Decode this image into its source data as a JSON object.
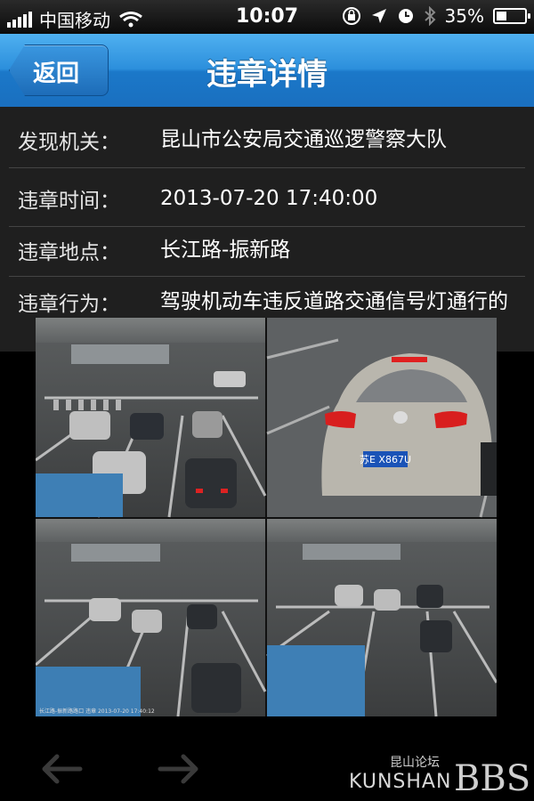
{
  "status_bar": {
    "carrier": "中国移动",
    "time": "10:07",
    "battery": "35%",
    "battery_level": 0.35
  },
  "nav": {
    "back_label": "返回",
    "title": "违章详情",
    "color": "#2c8fdc"
  },
  "details": [
    {
      "label": "发现机关：",
      "value": "昆山市公安局交通巡逻警察大队"
    },
    {
      "label": "违章时间：",
      "value": "2013-07-20 17:40:00"
    },
    {
      "label": "违章地点：",
      "value": "长江路-振新路"
    },
    {
      "label": "违章行为：",
      "value": "驾驶机动车违反道路交通信号灯通行的"
    }
  ],
  "photo": {
    "plate": "苏E X867U",
    "caption": "长江路-振新路路口 违章 2013-07-20 17:40:12"
  },
  "toolbar": {
    "prev_icon": "arrow-left-icon",
    "next_icon": "arrow-right-icon"
  },
  "watermark": {
    "small": "昆山论坛",
    "big": "KUNSHAN",
    "bbs": "BBS"
  }
}
